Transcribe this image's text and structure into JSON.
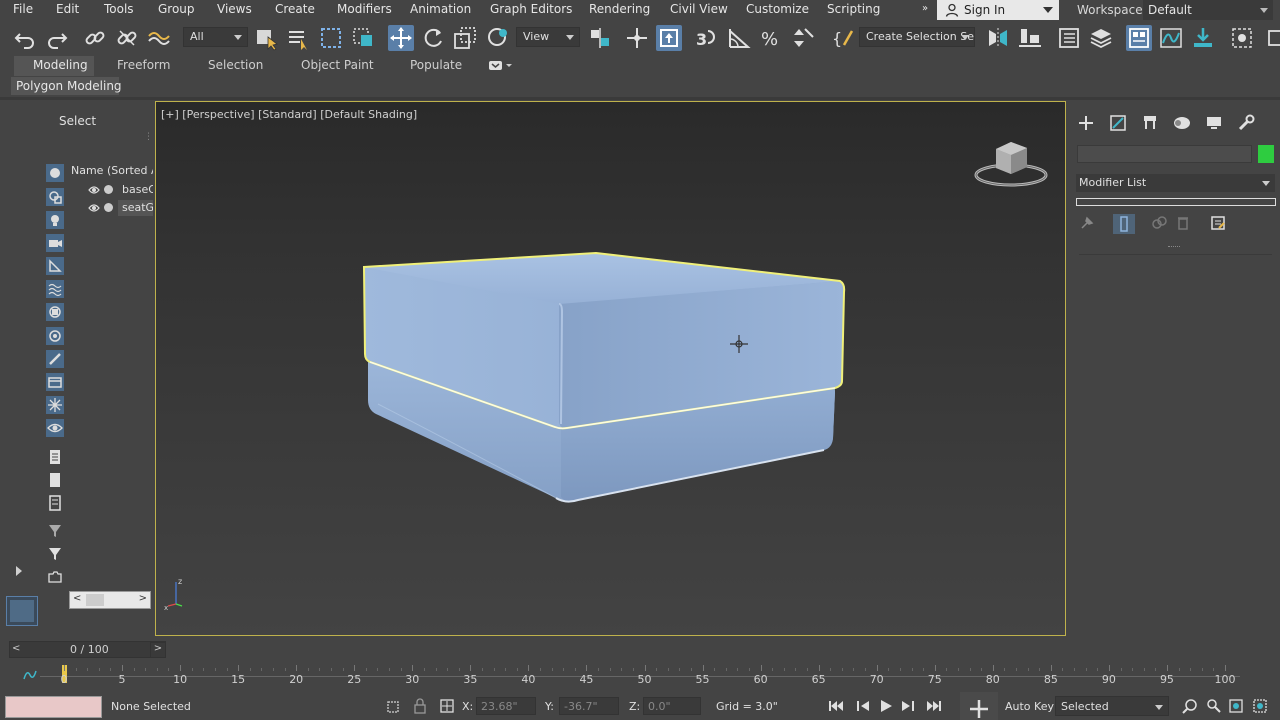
{
  "menu": {
    "items": [
      "File",
      "Edit",
      "Tools",
      "Group",
      "Views",
      "Create",
      "Modifiers",
      "Animation",
      "Graph Editors",
      "Rendering",
      "Civil View",
      "Customize",
      "Scripting"
    ],
    "sign_in": "Sign In",
    "workspaces_label": "Workspaces:",
    "workspaces_value": "Default"
  },
  "toolbar": {
    "filter_value": "All",
    "ref_coord_value": "View",
    "selection_set_value": "Create Selection Se"
  },
  "ribbon": {
    "tabs": [
      "Modeling",
      "Freeform",
      "Selection",
      "Object Paint",
      "Populate"
    ],
    "panel_label": "Polygon Modeling"
  },
  "explorer": {
    "select_label": "Select",
    "column_header": "Name (Sorted As",
    "objects": [
      "baseG",
      "seatG"
    ]
  },
  "viewport": {
    "label": "[+] [Perspective] [Standard] [Default Shading]"
  },
  "command_panel": {
    "modifier_list_label": "Modifier List",
    "color_swatch": "#2ecc40"
  },
  "timeline": {
    "frame_display": "0 / 100",
    "ticks": [
      0,
      5,
      10,
      15,
      20,
      25,
      30,
      35,
      40,
      45,
      50,
      55,
      60,
      65,
      70,
      75,
      80,
      85,
      90,
      95,
      100
    ],
    "current_frame": 0
  },
  "status": {
    "selection_text": "None Selected",
    "x_label": "X:",
    "x_value": "23.68\"",
    "y_label": "Y:",
    "y_value": "-36.7\"",
    "z_label": "Z:",
    "z_value": "0.0\"",
    "grid_text": "Grid = 3.0\"",
    "auto_key_label": "Auto Key",
    "key_filter_value": "Selected"
  },
  "colors": {
    "accent_blue": "#5a7fa8",
    "selection_yellow": "#e8e85a",
    "object_blue": "#8fa9cf"
  }
}
